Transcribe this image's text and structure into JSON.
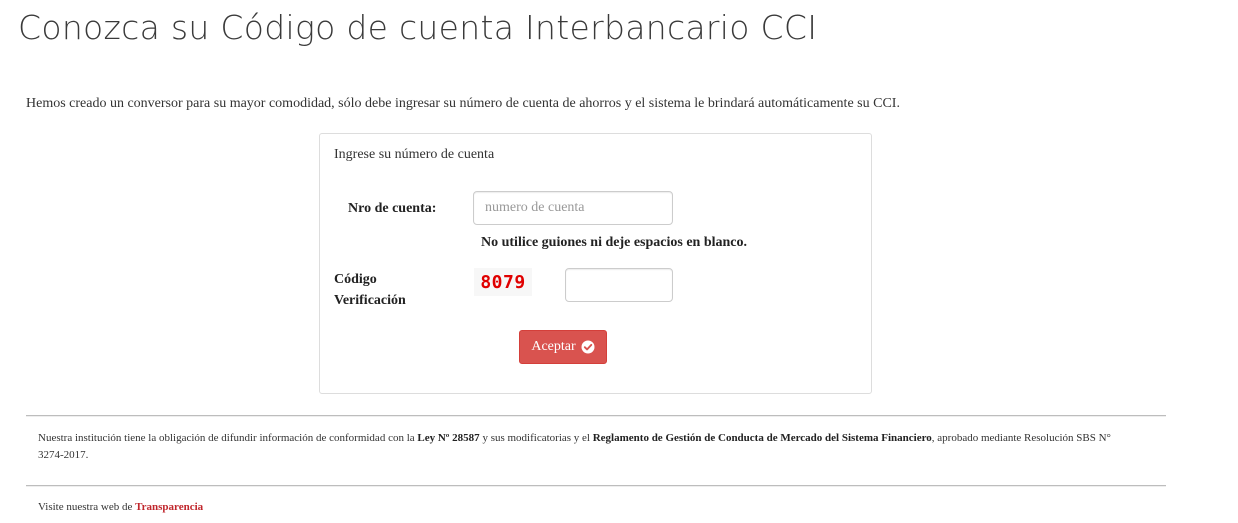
{
  "page": {
    "title": "Conozca su Código de cuenta Interbancario CCI",
    "intro": "Hemos creado un conversor para su mayor comodidad, sólo debe ingresar su número de cuenta de ahorros y el sistema le brindará automáticamente su CCI."
  },
  "form": {
    "heading": "Ingrese su número de cuenta",
    "account_label": "Nro de cuenta:",
    "account_placeholder": "numero de cuenta",
    "account_value": "",
    "hint": "No utilice guiones ni deje espacios en blanco.",
    "code_label_line1": "Código",
    "code_label_line2": "Verificación",
    "captcha_text": "8079",
    "code_value": "",
    "submit_label": "Aceptar",
    "submit_icon": "check-circle-icon"
  },
  "footer": {
    "legal_part1": "Nuestra institución tiene la obligación de difundir información de conformidad con la ",
    "legal_law": "Ley Nº 28587",
    "legal_part2": " y sus modificatorias y el ",
    "legal_regulation": "Reglamento de Gestión de Conducta de Mercado del Sistema Financiero",
    "legal_part3": ", aprobado mediante Resolución SBS N° 3274-2017.",
    "visit_text": "Visite nuestra web de ",
    "visit_link": "Transparencia"
  },
  "colors": {
    "button": "#d9534f",
    "captcha": "#e00000",
    "link": "#c0262c"
  }
}
